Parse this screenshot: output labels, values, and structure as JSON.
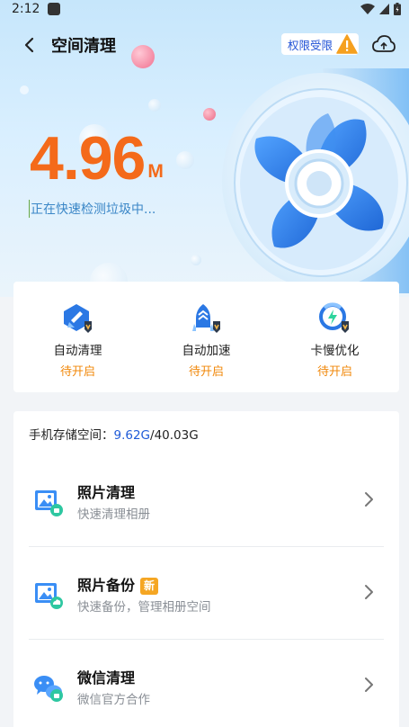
{
  "status_bar": {
    "time": "2:12"
  },
  "header": {
    "title": "空间清理",
    "permission_label": "权限受限"
  },
  "scan": {
    "size_value": "4.96",
    "size_unit": "M",
    "status_text": "正在快速检测垃圾中..."
  },
  "features": [
    {
      "label": "自动清理",
      "state": "待开启",
      "icon": "auto-clean-icon"
    },
    {
      "label": "自动加速",
      "state": "待开启",
      "icon": "auto-speed-icon"
    },
    {
      "label": "卡慢优化",
      "state": "待开启",
      "icon": "lag-optimize-icon"
    }
  ],
  "storage": {
    "label": "手机存储空间：",
    "used": "9.62G",
    "total": "/40.03G"
  },
  "tools": [
    {
      "title": "照片清理",
      "subtitle": "快速清理相册",
      "badge": "",
      "icon": "photo-clean-icon"
    },
    {
      "title": "照片备份",
      "subtitle": "快速备份，管理相册空间",
      "badge": "新",
      "icon": "photo-backup-icon"
    },
    {
      "title": "微信清理",
      "subtitle": "微信官方合作",
      "badge": "",
      "icon": "wechat-clean-icon"
    }
  ],
  "colors": {
    "accent_orange": "#f46a1a",
    "pending_orange": "#f1880b",
    "brand_blue": "#1f5bd8",
    "fan_blue": "#2b7de9"
  }
}
